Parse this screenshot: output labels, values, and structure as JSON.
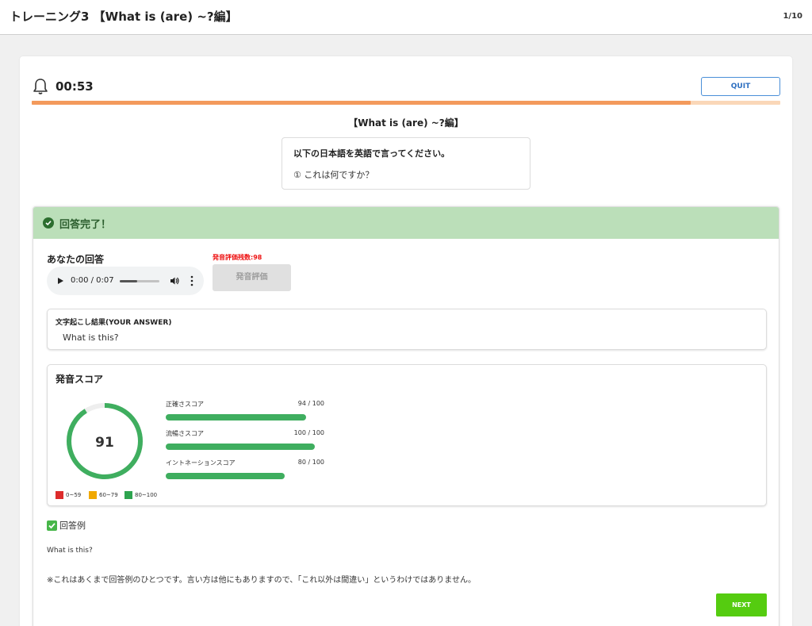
{
  "header": {
    "title": "トレーニング3 【What is (are) ~?編】",
    "counter": "1/10"
  },
  "timer": {
    "icon": "bell-icon",
    "value": "00:53"
  },
  "quit_label": "QUIT",
  "progress": {
    "fraction": 0.88,
    "fill_color": "#f39a5c",
    "track_color": "#fad7b8"
  },
  "section_title": "【What is (are) ~?編】",
  "question": {
    "instruction": "以下の日本語を英語で言ってください。",
    "item": "① これは何ですか？"
  },
  "result": {
    "status": "回答完了！",
    "your_answer_label": "あなたの回答",
    "remaining_evaluations": "発音評価残数:98",
    "audio": {
      "time": "0:00 / 0:07",
      "played_fraction": 0.44
    },
    "evaluate_button": "発音評価",
    "transcript": {
      "label": "文字起こし結果(YOUR ANSWER)",
      "text": "What is this?"
    },
    "score": {
      "title": "発音スコア",
      "overall": "91",
      "overall_fraction": 0.91,
      "metrics": [
        {
          "label": "正確さスコア",
          "value": "94 / 100",
          "fraction": 0.94
        },
        {
          "label": "流暢さスコア",
          "value": "100 / 100",
          "fraction": 1.0
        },
        {
          "label": "イントネーションスコア",
          "value": "80 / 100",
          "fraction": 0.8
        }
      ],
      "legend": [
        {
          "label": "0~59",
          "color": "#dd2b2b"
        },
        {
          "label": "60~79",
          "color": "#f0a800"
        },
        {
          "label": "80~100",
          "color": "#2ea44f"
        }
      ]
    },
    "example": {
      "heading": "回答例",
      "text": "What is this?",
      "note": "※これはあくまで回答例のひとつです。言い方は他にもありますので、「これ以外は間違い」というわけではありません。"
    },
    "next_label": "NEXT"
  },
  "colors": {
    "accent": "#55cc10",
    "success_bg": "#bbdfb9",
    "score_green": "#3fae5f",
    "error": "#e11"
  }
}
